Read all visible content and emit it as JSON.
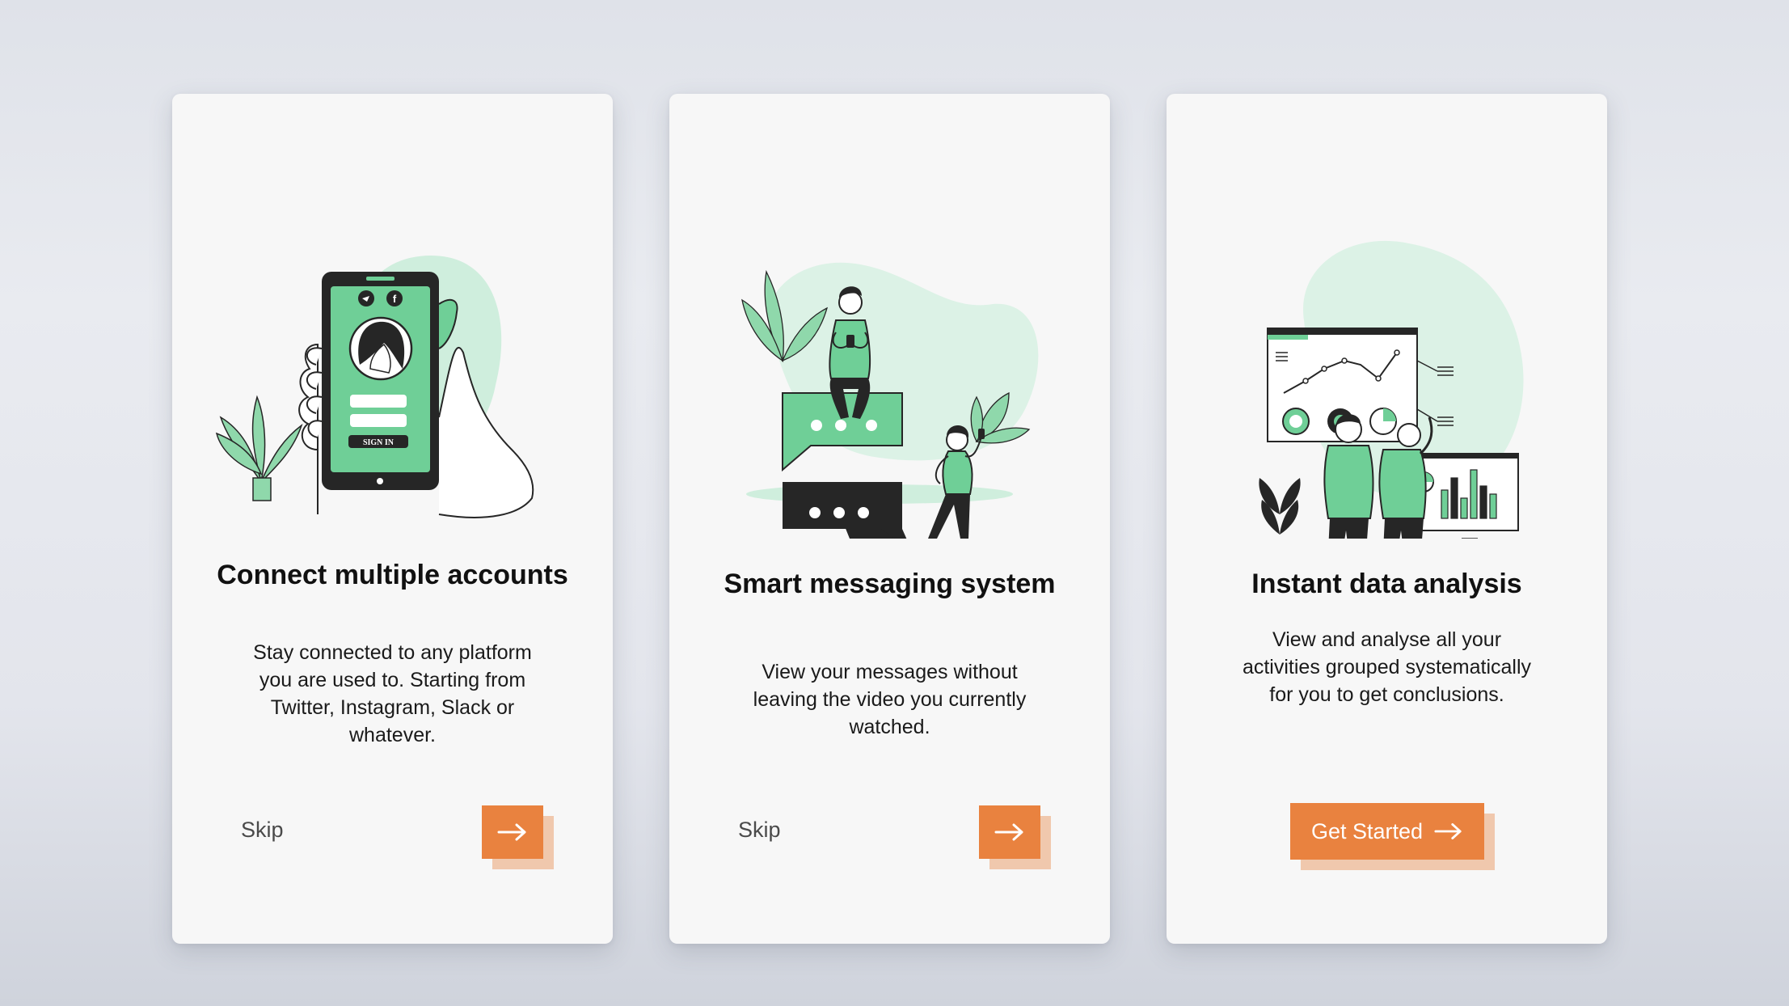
{
  "colors": {
    "accent": "#e9823f",
    "accent_shadow": "#f0c8ad",
    "illustration_green": "#6fcf97",
    "illustration_dark": "#262626",
    "card_background": "#f7f7f7"
  },
  "cards": [
    {
      "illustration": "phone-sign-in-icon",
      "phone_button_label": "SIGN IN",
      "title": "Connect multiple accounts",
      "description": "Stay connected to any platform you are used to. Starting from Twitter, Instagram, Slack or whatever.",
      "skip_label": "Skip",
      "next_icon": "arrow-right-icon"
    },
    {
      "illustration": "chat-bubbles-icon",
      "title": "Smart messaging system",
      "description": "View your messages without leaving the video you currently watched.",
      "skip_label": "Skip",
      "next_icon": "arrow-right-icon"
    },
    {
      "illustration": "dashboard-analysis-icon",
      "title": "Instant data analysis",
      "description": "View and analyse all your activities grouped systematically for you to get conclusions.",
      "cta_label": "Get Started",
      "cta_icon": "arrow-right-icon"
    }
  ]
}
